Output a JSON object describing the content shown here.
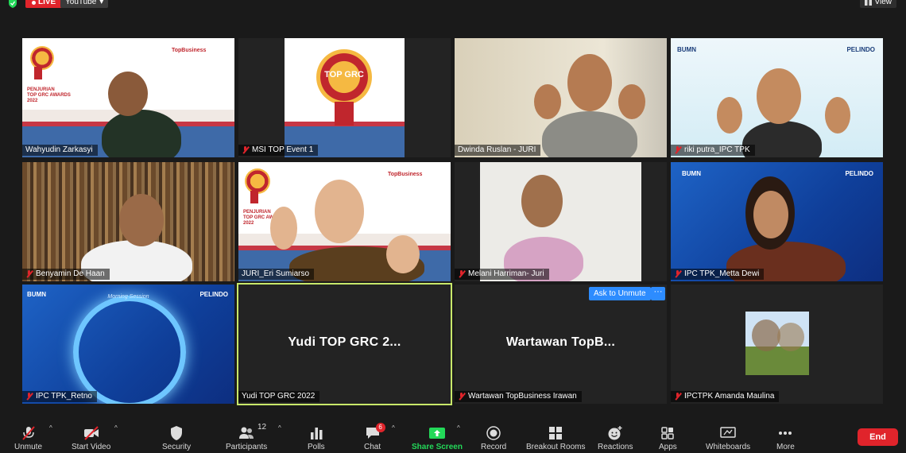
{
  "topbar": {
    "live_label": "LIVE",
    "youtube_label": "YouTube",
    "view_label": "View"
  },
  "tiles": [
    {
      "name": "Wahyudin Zarkasyi",
      "muted": false
    },
    {
      "name": "MSI TOP Event 1",
      "muted": true
    },
    {
      "name": "Dwinda Ruslan - JURI",
      "muted": false
    },
    {
      "name": "riki putra_IPC TPK",
      "muted": true
    },
    {
      "name": "Benyamin De Haan",
      "muted": true
    },
    {
      "name": "JURI_Eri Sumiarso",
      "muted": false
    },
    {
      "name": "Melani Harriman- Juri",
      "muted": true
    },
    {
      "name": "IPC TPK_Metta Dewi",
      "muted": true
    },
    {
      "name": "IPC TPK_Retno",
      "muted": true
    },
    {
      "name": "Yudi  TOP GRC 2022",
      "big": "Yudi  TOP GRC 2...",
      "muted": false
    },
    {
      "name": "Wartawan TopBusiness Irawan",
      "big": "Wartawan TopB...",
      "muted": true
    },
    {
      "name": "IPCTPK Amanda Maulina",
      "muted": true
    }
  ],
  "slides": {
    "banner_lines": [
      "PENJURIAN",
      "TOP GRC AWARDS",
      "2022"
    ],
    "badge_text": "TOP GRC",
    "topbusiness": "TopBusiness",
    "bumn": "BUMN",
    "pelindo": "PELINDO",
    "retno_title": "Morning Session"
  },
  "ask_to_unmute": "Ask to Unmute",
  "more_dots": "···",
  "toolbar": {
    "unmute": "Unmute",
    "start_video": "Start Video",
    "security": "Security",
    "participants": "Participants",
    "participants_count": "12",
    "polls": "Polls",
    "chat": "Chat",
    "chat_badge": "6",
    "share_screen": "Share Screen",
    "record": "Record",
    "breakout_rooms": "Breakout Rooms",
    "reactions": "Reactions",
    "apps": "Apps",
    "whiteboards": "Whiteboards",
    "more": "More",
    "end": "End"
  },
  "colors": {
    "accent_blue": "#2d8cff",
    "live_red": "#e0242b",
    "share_green": "#23d959",
    "active_speaker": "#c8e86a"
  }
}
